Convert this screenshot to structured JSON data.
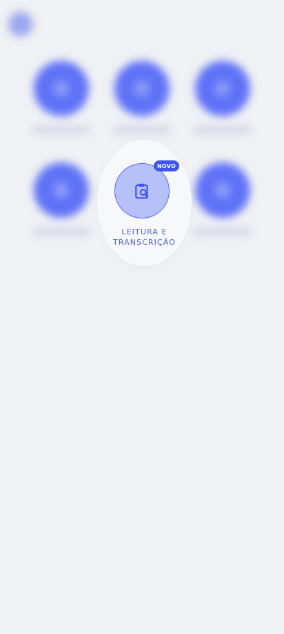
{
  "colors": {
    "background": "#f0f1f4",
    "accent": "#3f55ef",
    "circle_blur": "#5f72f7",
    "circle_focus": "#b6c1fa"
  },
  "focused_item": {
    "badge": "NOVO",
    "label_line1": "LEITURA E",
    "label_line2": "TRANSCRIÇÃO",
    "icon": "clipboard-search-icon"
  }
}
